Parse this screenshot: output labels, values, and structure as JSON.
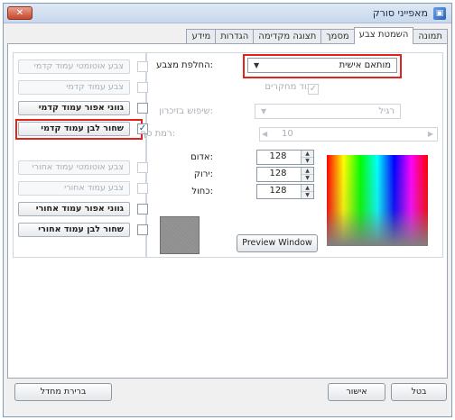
{
  "window": {
    "title": "מאפייני סורק",
    "close_label": "✕"
  },
  "tabs": [
    {
      "label": "תמונה",
      "active": false
    },
    {
      "label": "השמטת צבע",
      "active": true
    },
    {
      "label": "מסמך",
      "active": false
    },
    {
      "label": "תצוגה מקדימה",
      "active": false
    },
    {
      "label": "הגדרות",
      "active": false
    },
    {
      "label": "מידע",
      "active": false
    }
  ],
  "image_list": [
    {
      "label": "צבע אוטומטי עמוד קדמי",
      "enabled": false,
      "checked": false
    },
    {
      "label": "צבע עמוד קדמי",
      "enabled": false,
      "checked": false
    },
    {
      "label": "גווני אפור עמוד קדמי",
      "enabled": true,
      "checked": false
    },
    {
      "label": "שחור לבן עמוד קדמי",
      "enabled": true,
      "checked": true
    },
    {
      "label": "צבע אוטומטי עמוד אחורי",
      "enabled": false,
      "checked": false
    },
    {
      "label": "צבע עמוד אחורי",
      "enabled": false,
      "checked": false
    },
    {
      "label": "גווני אפור עמוד אחורי",
      "enabled": true,
      "checked": false
    },
    {
      "label": "שחור לבן עמוד אחורי",
      "enabled": true,
      "checked": false
    }
  ],
  "dropout": {
    "label": "החלפת מצבע:",
    "value": "מותאם אישית",
    "remove_bg_label": "עיבוד מחקרים",
    "remove_bg_checked": true
  },
  "enhance": {
    "label": "שיפוש בזיכרון:",
    "value": "רגיל"
  },
  "level": {
    "label": "רמת סף:",
    "value": "10"
  },
  "rgb": {
    "red_label": "אדום:",
    "red_value": "128",
    "green_label": "ירוק:",
    "green_value": "128",
    "blue_label": "כחול:",
    "blue_value": "128",
    "swatch_color": "#8f8f8f"
  },
  "preview_button": "Preview Window",
  "buttons": {
    "defaults": "ברירת מחדל",
    "ok": "אישור",
    "cancel": "בטל"
  },
  "colors": {
    "highlight": "#e0241b",
    "checkmark": "#1a4f9c"
  }
}
